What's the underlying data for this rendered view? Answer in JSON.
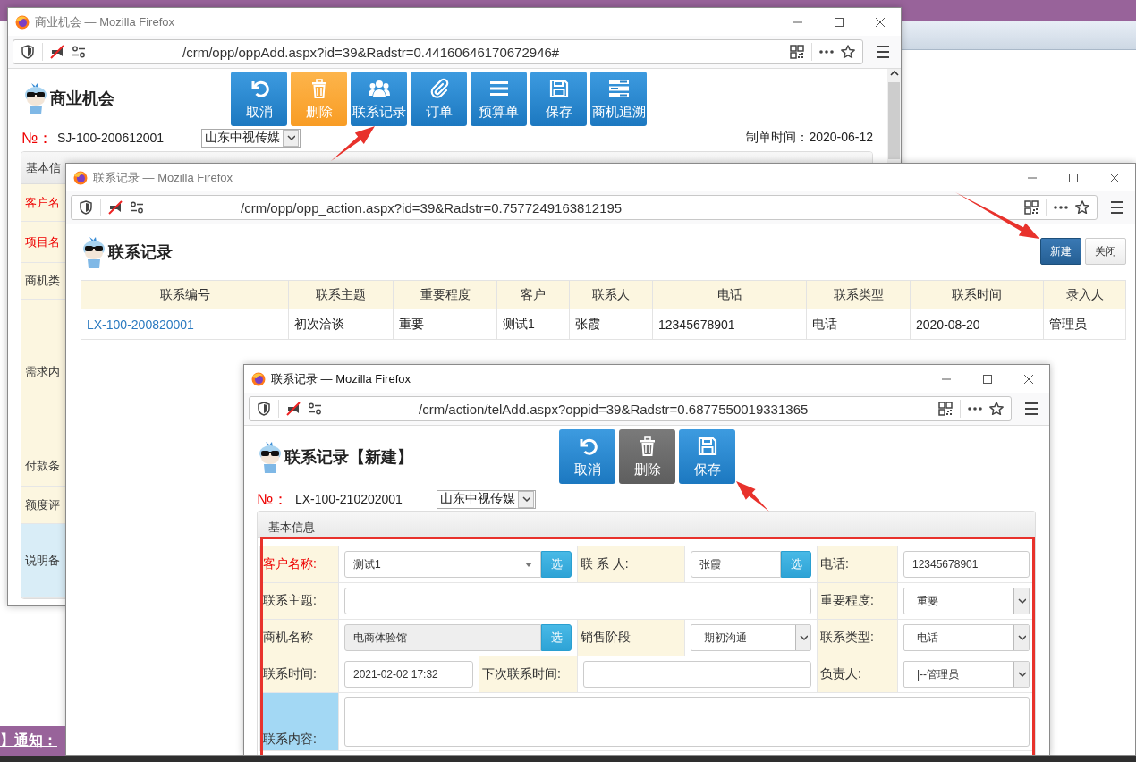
{
  "desktop": {
    "notice": "】通知："
  },
  "opportunity_window": {
    "title": "商业机会 — Mozilla Firefox",
    "active": false,
    "url": "/crm/opp/oppAdd.aspx?id=39&Radstr=0.44160646170672946#",
    "page_title": "商业机会",
    "toolbar": [
      {
        "label": "取消",
        "kind": "primary"
      },
      {
        "label": "删除",
        "kind": "warning"
      },
      {
        "label": "联系记录",
        "kind": "primary"
      },
      {
        "label": "订单",
        "kind": "primary"
      },
      {
        "label": "预算单",
        "kind": "primary"
      },
      {
        "label": "保存",
        "kind": "primary"
      },
      {
        "label": "商机追溯",
        "kind": "primary"
      }
    ],
    "number_label": "№：",
    "number": "SJ-100-200612001",
    "company": "山东中视传媒",
    "created": "制单时间：2020-06-12",
    "panel_title": "基本信",
    "fields": [
      {
        "label": "客户名",
        "required": true,
        "highlighted": false
      },
      {
        "label": "项目名",
        "required": true,
        "highlighted": false
      },
      {
        "label": "商机类",
        "required": false,
        "highlighted": false
      },
      {
        "label": "需求内",
        "required": false,
        "highlighted": false
      },
      {
        "label": "付款条",
        "required": false,
        "highlighted": false
      },
      {
        "label": "额度评",
        "required": false,
        "highlighted": false
      },
      {
        "label": "说明备",
        "required": false,
        "highlighted": true
      }
    ]
  },
  "contact_list_window": {
    "title": "联系记录 — Mozilla Firefox",
    "active": false,
    "url": "/crm/opp/opp_action.aspx?id=39&Radstr=0.7577249163812195",
    "page_title": "联系记录",
    "buttons": [
      {
        "label": "新建",
        "kind": "dark"
      },
      {
        "label": "关闭",
        "kind": "default"
      }
    ],
    "table": {
      "columns": [
        "联系编号",
        "联系主题",
        "重要程度",
        "客户",
        "联系人",
        "电话",
        "联系类型",
        "联系时间",
        "录入人"
      ],
      "rows": [
        {
          "cells": [
            "LX-100-200820001",
            "初次洽谈",
            "重要",
            "测试1",
            "张霞",
            "12345678901",
            "电话",
            "2020-08-20",
            "管理员"
          ]
        }
      ]
    }
  },
  "contact_new_window": {
    "title": "联系记录 — Mozilla Firefox",
    "active": true,
    "url": "/crm/action/telAdd.aspx?oppid=39&Radstr=0.6877550019331365",
    "page_title": "联系记录【新建】",
    "toolbar": [
      {
        "label": "取消",
        "kind": "primary"
      },
      {
        "label": "删除",
        "kind": "muted"
      },
      {
        "label": "保存",
        "kind": "primary"
      }
    ],
    "number_label": "№：",
    "number": "LX-100-210202001",
    "company": "山东中视传媒",
    "panel_title": "基本信息",
    "form_rows": [
      {
        "cells": [
          {
            "kind": "label",
            "text": "客户名称:",
            "required": true,
            "highlighted": false
          },
          {
            "kind": "combo",
            "value": "测试1",
            "pick": "选"
          },
          {
            "kind": "label",
            "text": "联 系 人:",
            "required": false,
            "highlighted": false
          },
          {
            "kind": "pick",
            "value": "张霞",
            "pick": "选",
            "disabled": false
          },
          {
            "kind": "label",
            "text": "电话:",
            "required": false,
            "highlighted": false
          },
          {
            "kind": "input",
            "value": "12345678901"
          }
        ]
      },
      {
        "cells": [
          {
            "kind": "label",
            "text": "联系主题:",
            "required": false,
            "highlighted": false
          },
          {
            "kind": "input"
          },
          {
            "kind": "label",
            "text": "重要程度:",
            "required": false,
            "highlighted": false
          },
          {
            "kind": "select",
            "value": "重要"
          }
        ]
      },
      {
        "cells": [
          {
            "kind": "label",
            "text": "商机名称",
            "required": false,
            "highlighted": false
          },
          {
            "kind": "pick",
            "value": "电商体验馆",
            "pick": "选",
            "disabled": true
          },
          {
            "kind": "label",
            "text": "销售阶段",
            "required": false,
            "highlighted": false
          },
          {
            "kind": "select",
            "value": "期初沟通"
          },
          {
            "kind": "label",
            "text": "联系类型:",
            "required": false,
            "highlighted": false
          },
          {
            "kind": "select",
            "value": "电话"
          }
        ]
      },
      {
        "cells": [
          {
            "kind": "label",
            "text": "联系时间:",
            "required": false,
            "highlighted": false
          },
          {
            "kind": "input",
            "value": "2021-02-02 17:32"
          },
          {
            "kind": "label",
            "text": "下次联系时间:",
            "required": false,
            "highlighted": false
          },
          {
            "kind": "input"
          },
          {
            "kind": "label",
            "text": "负责人:",
            "required": false,
            "highlighted": false
          },
          {
            "kind": "select",
            "value": "|--管理员"
          }
        ]
      },
      {
        "cells": [
          {
            "kind": "label",
            "text": "联系内容:",
            "required": false,
            "highlighted": true
          },
          {
            "kind": "textarea"
          }
        ]
      }
    ]
  }
}
